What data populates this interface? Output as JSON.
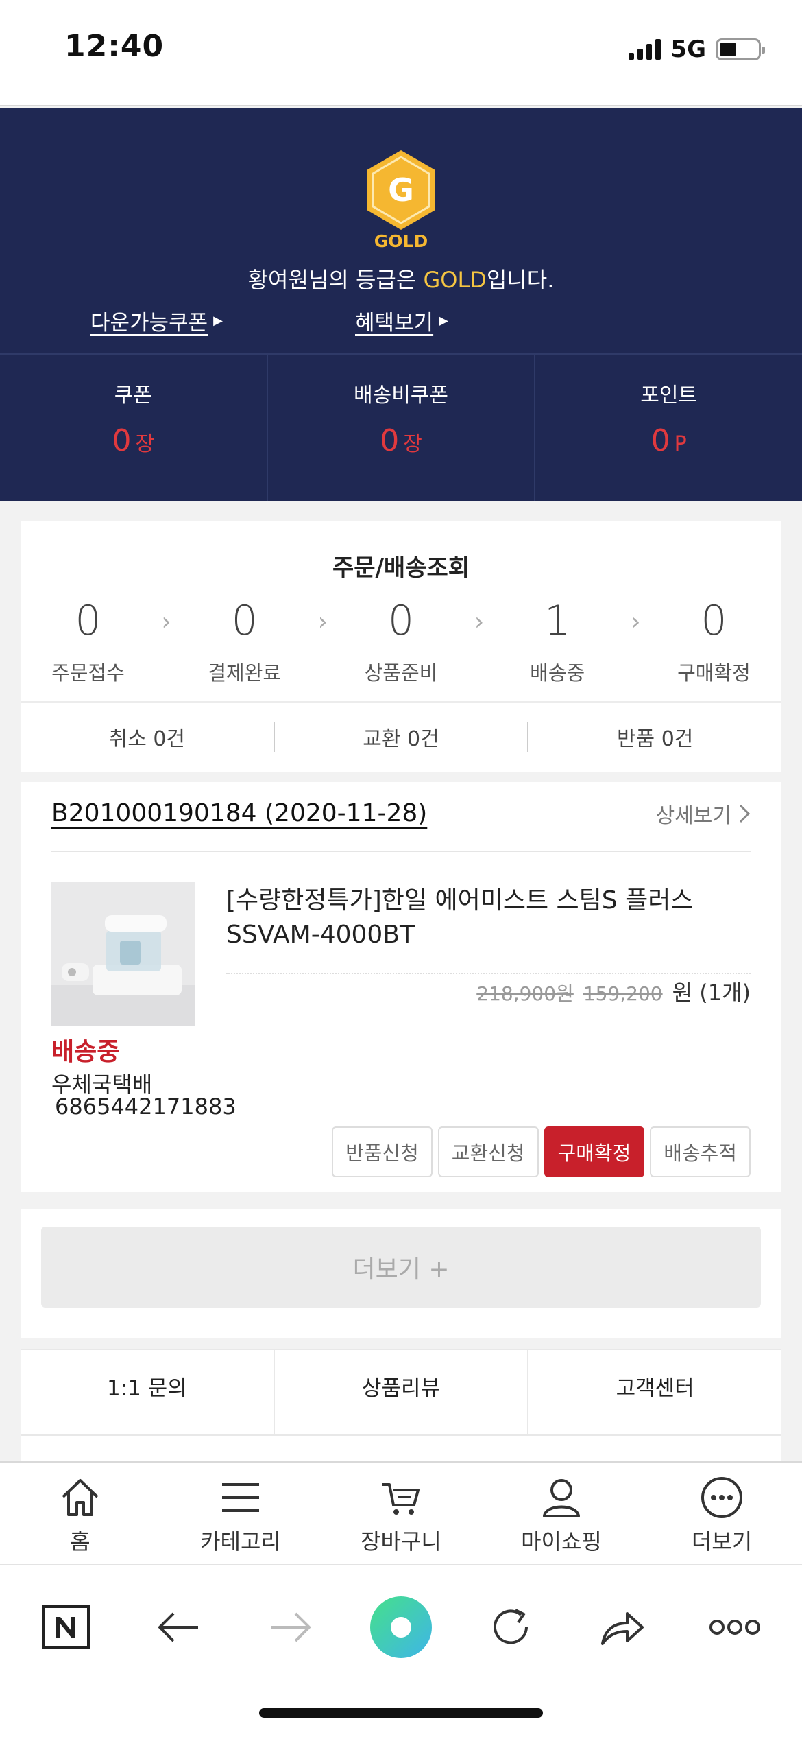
{
  "status": {
    "time": "12:40",
    "network": "5G",
    "battery_level": 0.45
  },
  "grade": {
    "badge_letter": "G",
    "badge_name": "GOLD",
    "msg_pre": "황여원님의 등급은 ",
    "msg_grade": "GOLD",
    "msg_post": "입니다.",
    "coupon_link": "다운가능쿠폰",
    "benefit_link": "혜택보기"
  },
  "stats": [
    {
      "label": "쿠폰",
      "value": "0",
      "unit": "장"
    },
    {
      "label": "배송비쿠폰",
      "value": "0",
      "unit": "장"
    },
    {
      "label": "포인트",
      "value": "0",
      "unit": "P"
    }
  ],
  "orders": {
    "title": "주문/배송조회",
    "steps": [
      {
        "count": "0",
        "label": "주문접수"
      },
      {
        "count": "0",
        "label": "결제완료"
      },
      {
        "count": "0",
        "label": "상품준비"
      },
      {
        "count": "1",
        "label": "배송중"
      },
      {
        "count": "0",
        "label": "구매확정"
      }
    ],
    "claims": [
      "취소 0건",
      "교환 0건",
      "반품 0건"
    ]
  },
  "order_item": {
    "order_no": "B201000190184 (2020-11-28)",
    "detail_label": "상세보기",
    "name": "[수량한정특가]한일 에어미스트 스팀S 플러스 SSVAM-4000BT",
    "price_list": "218,900원",
    "price_sale": "159,200",
    "price_unit": "원 (1개)",
    "status": "배송중",
    "carrier": "우체국택배",
    "tracking": "6865442171883",
    "buttons": {
      "return": "반품신청",
      "exchange": "교환신청",
      "confirm": "구매확정",
      "track": "배송추적"
    },
    "more": "더보기 +"
  },
  "menu": [
    "1:1 문의",
    "상품리뷰",
    "고객센터"
  ],
  "tabs": [
    {
      "label": "홈",
      "icon": "home-icon"
    },
    {
      "label": "카테고리",
      "icon": "menu-icon"
    },
    {
      "label": "장바구니",
      "icon": "cart-icon"
    },
    {
      "label": "마이쇼핑",
      "icon": "user-icon"
    },
    {
      "label": "더보기",
      "icon": "more-icon"
    }
  ],
  "colors": {
    "header_bg": "#1f2853",
    "accent_red": "#c8202b",
    "gold": "#f5b731"
  }
}
